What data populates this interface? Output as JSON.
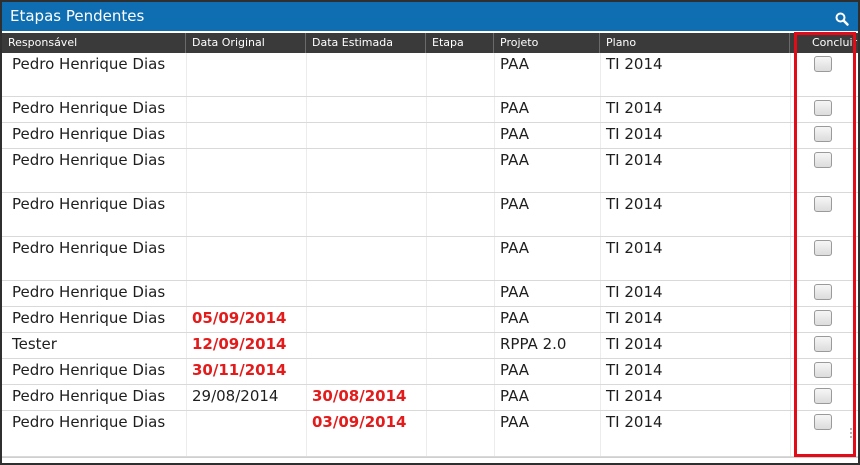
{
  "title": "Etapas Pendentes",
  "columns": {
    "responsavel": "Responsável",
    "data_original": "Data Original",
    "data_estimada": "Data Estimada",
    "etapa": "Etapa",
    "projeto": "Projeto",
    "plano": "Plano",
    "concluir": "Concluir"
  },
  "rows": [
    {
      "responsavel": "Pedro Henrique Dias",
      "data_original": "",
      "data_estimada": "",
      "etapa": "",
      "projeto": "PAA",
      "plano": "TI 2014"
    },
    {
      "responsavel": "Pedro Henrique Dias",
      "data_original": "",
      "data_estimada": "",
      "etapa": "",
      "projeto": "PAA",
      "plano": "TI 2014"
    },
    {
      "responsavel": "Pedro Henrique Dias",
      "data_original": "",
      "data_estimada": "",
      "etapa": "",
      "projeto": "PAA",
      "plano": "TI 2014"
    },
    {
      "responsavel": "Pedro Henrique Dias",
      "data_original": "",
      "data_estimada": "",
      "etapa": "",
      "projeto": "PAA",
      "plano": "TI 2014"
    },
    {
      "responsavel": "Pedro Henrique Dias",
      "data_original": "",
      "data_estimada": "",
      "etapa": "",
      "projeto": "PAA",
      "plano": "TI 2014"
    },
    {
      "responsavel": "Pedro Henrique Dias",
      "data_original": "",
      "data_estimada": "",
      "etapa": "",
      "projeto": "PAA",
      "plano": "TI 2014"
    },
    {
      "responsavel": "Pedro Henrique Dias",
      "data_original": "",
      "data_estimada": "",
      "etapa": "",
      "projeto": "PAA",
      "plano": "TI 2014"
    },
    {
      "responsavel": "Pedro Henrique Dias",
      "data_original": "05/09/2014",
      "data_estimada": "",
      "etapa": "",
      "projeto": "PAA",
      "plano": "TI 2014"
    },
    {
      "responsavel": "Tester",
      "data_original": "12/09/2014",
      "data_estimada": "",
      "etapa": "",
      "projeto": "RPPA 2.0",
      "plano": "TI 2014"
    },
    {
      "responsavel": "Pedro Henrique Dias",
      "data_original": "30/11/2014",
      "data_estimada": "",
      "etapa": "",
      "projeto": "PAA",
      "plano": "TI 2014"
    },
    {
      "responsavel": "Pedro Henrique Dias",
      "data_original": "29/08/2014",
      "data_estimada": "30/08/2014",
      "etapa": "",
      "projeto": "PAA",
      "plano": "TI 2014"
    },
    {
      "responsavel": "Pedro Henrique Dias",
      "data_original": "",
      "data_estimada": "03/09/2014",
      "etapa": "",
      "projeto": "PAA",
      "plano": "TI 2014"
    }
  ],
  "colors": {
    "titlebar": "#0f6db1",
    "header": "#3a3a3a",
    "overdue_date": "#e31b1b",
    "highlight_box": "#e30b17"
  },
  "icons": {
    "search": "search-icon"
  }
}
